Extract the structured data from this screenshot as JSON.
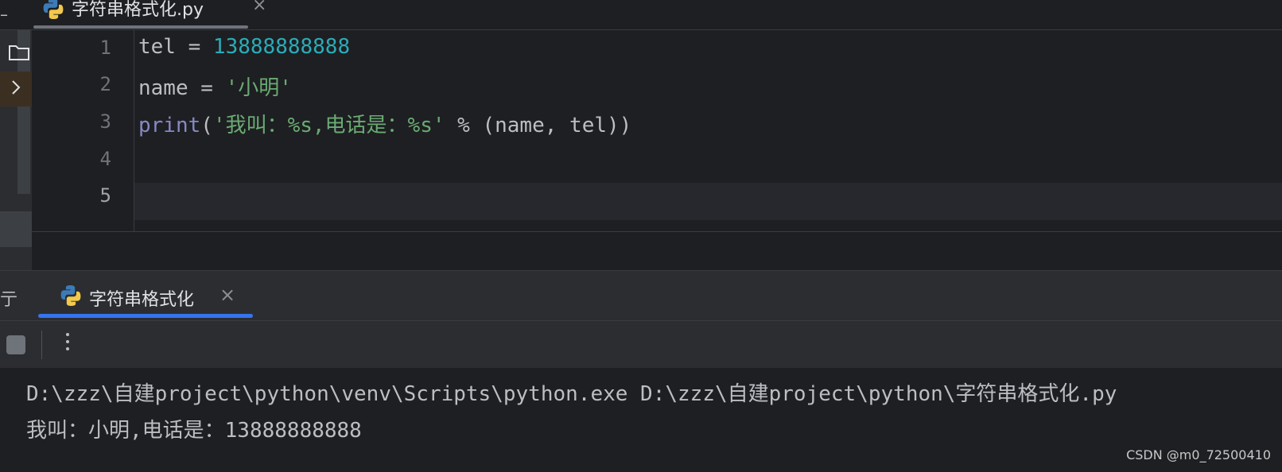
{
  "editor": {
    "tab_title": "字符串格式化.py",
    "line_numbers": [
      "1",
      "2",
      "3",
      "4",
      "5"
    ],
    "code": {
      "line1": {
        "a": "tel = ",
        "b": "13888888888"
      },
      "line2": {
        "a": "name = ",
        "b": "'小明'"
      },
      "line3": {
        "fn": "print",
        "p1": "(",
        "s": "'我叫：%s,电话是：%s'",
        "rest": " % (name, tel))"
      }
    }
  },
  "run": {
    "partial_label": "亍",
    "tab_title": "字符串格式化",
    "output": [
      "D:\\zzz\\自建project\\python\\venv\\Scripts\\python.exe D:\\zzz\\自建project\\python\\字符串格式化.py",
      "我叫：小明,电话是：13888888888"
    ]
  },
  "watermark": "CSDN @m0_72500410",
  "icons": {
    "file": "python-icon",
    "close": "close-icon",
    "folder": "folder-icon",
    "chevron": "chevron-right-icon",
    "stop": "stop-icon",
    "more": "more-vertical-icon"
  },
  "colors": {
    "background": "#1e1f22",
    "panel": "#2b2d30",
    "number": "#2aacb8",
    "string": "#6aab73",
    "builtin": "#8888c6",
    "accent": "#3574f0"
  }
}
